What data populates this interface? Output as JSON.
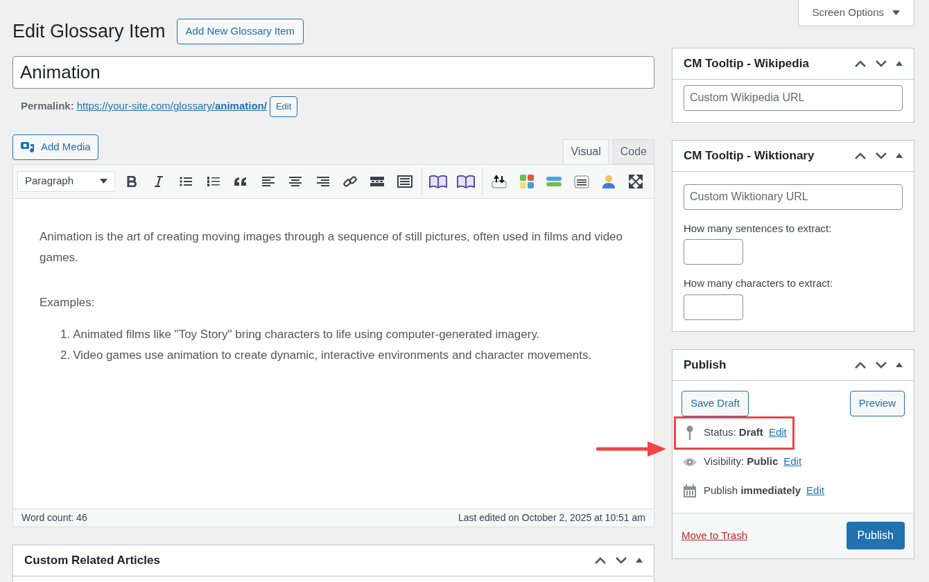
{
  "screen_options": "Screen Options",
  "page_title": "Edit Glossary Item",
  "add_new_button": "Add New Glossary Item",
  "title_field": {
    "value": "Animation"
  },
  "permalink": {
    "label": "Permalink:",
    "url": "https://your-site.com/glossary/**animation/**",
    "edit_button": "Edit"
  },
  "add_media_button": "Add Media",
  "editor_tabs": [
    {
      "label": "Visual",
      "selected": true
    },
    {
      "label": "Code",
      "selected": false
    }
  ],
  "format_select": "Paragraph",
  "content": {
    "paragraph": "Animation is the art of creating moving images through a sequence of still pictures, often used in films and video games.",
    "examples_label": "Examples:",
    "examples": [
      {
        "number": "1.",
        "text": "Animated films like \"Toy Story\" bring characters to life using computer-generated imagery."
      },
      {
        "number": "2.",
        "text": "Video games use animation to create dynamic, interactive environments and character movements."
      }
    ]
  },
  "status_bar": {
    "word_count": "Word count: 46",
    "last_edited": "Last edited on October 2, 2025 at 10:51 am"
  },
  "related_box": {
    "title": "Custom Related Articles"
  },
  "wikipedia_box": {
    "title": "CM Tooltip - Wikipedia",
    "url_field": {
      "placeholder": "Custom Wikipedia URL"
    }
  },
  "wiktionary_box": {
    "title": "CM Tooltip - Wiktionary",
    "url_field": {
      "placeholder": "Custom Wiktionary URL"
    },
    "fields": [
      {
        "label": "How many sentences to extract:"
      },
      {
        "label": "How many characters to extract:"
      }
    ]
  },
  "publish_box": {
    "title": "Publish",
    "save_draft_button": "Save Draft",
    "preview_button": "Preview",
    "rows": [
      {
        "kind": "status",
        "text": "Status: **Draft**",
        "link": "Edit",
        "highlighted": true
      },
      {
        "kind": "visibility",
        "text": "Visibility: **Public**",
        "link": "Edit",
        "highlighted": false
      },
      {
        "kind": "schedule",
        "text": "Publish **immediately**",
        "link": "Edit",
        "highlighted": false
      }
    ],
    "trash_link": "Move to Trash",
    "publish_button": "Publish"
  }
}
